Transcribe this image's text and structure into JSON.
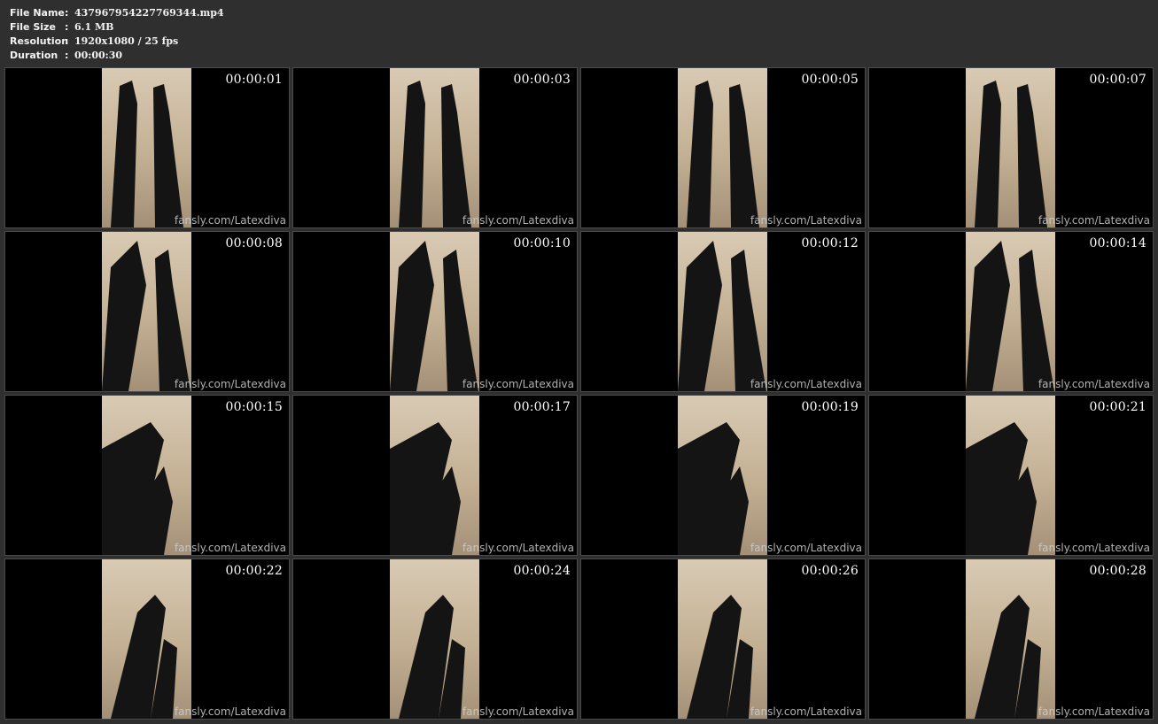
{
  "info": {
    "file_name_label": "File Name",
    "file_name": "437967954227769344.mp4",
    "file_size_label": "File Size",
    "file_size": "6.1 MB",
    "resolution_label": "Resolution",
    "resolution": "1920x1080 / 25 fps",
    "duration_label": "Duration",
    "duration": "00:00:30",
    "separator": ":"
  },
  "watermark": "fansly.com/Latexdiva",
  "thumbnails": [
    {
      "timestamp": "00:00:01"
    },
    {
      "timestamp": "00:00:03"
    },
    {
      "timestamp": "00:00:05"
    },
    {
      "timestamp": "00:00:07"
    },
    {
      "timestamp": "00:00:08"
    },
    {
      "timestamp": "00:00:10"
    },
    {
      "timestamp": "00:00:12"
    },
    {
      "timestamp": "00:00:14"
    },
    {
      "timestamp": "00:00:15"
    },
    {
      "timestamp": "00:00:17"
    },
    {
      "timestamp": "00:00:19"
    },
    {
      "timestamp": "00:00:21"
    },
    {
      "timestamp": "00:00:22"
    },
    {
      "timestamp": "00:00:24"
    },
    {
      "timestamp": "00:00:26"
    },
    {
      "timestamp": "00:00:28"
    }
  ]
}
